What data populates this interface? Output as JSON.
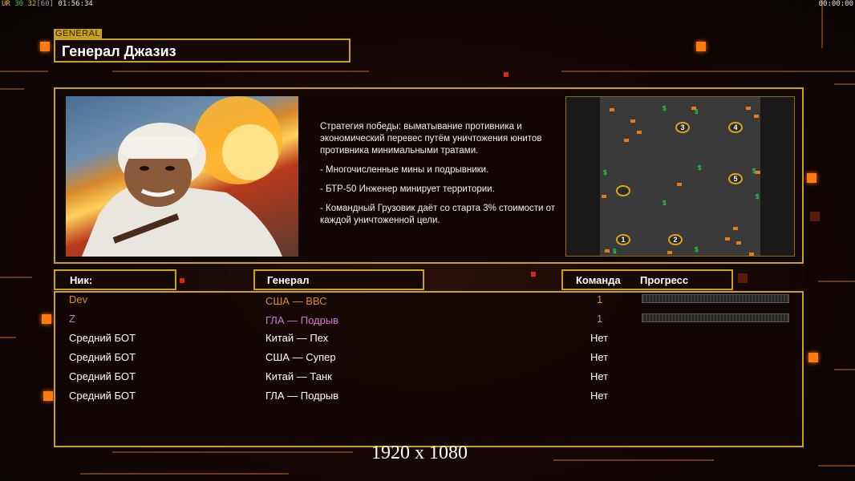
{
  "hud": {
    "ur_label": "UR",
    "fps_a": "30",
    "fps_b": "32",
    "fps_c": "[60]",
    "time_left": "01:56:34",
    "time_right": "00:00:00"
  },
  "header": {
    "tag": "GENERAL",
    "title": "Генерал Джазиз"
  },
  "description": {
    "strategy": "Стратегия победы: выматывание противника и экономический перевес путём уничтожения юнитов противника минимальными тратами.",
    "bullet1": "- Многочисленные мины и подрывники.",
    "bullet2": "- БТР-50 Инженер минирует территории.",
    "bullet3": "- Командный Грузовик даёт со старта 3% стоимости от каждой уничтоженной цели."
  },
  "map": {
    "starts": [
      "1",
      "2",
      "3",
      "4",
      "5"
    ],
    "colors": {
      "start_ring": "#d9a51a",
      "money": "#29d14a",
      "unit": "#e57a1a"
    }
  },
  "table": {
    "headers": {
      "nick": "Ник:",
      "general": "Генерал",
      "team": "Команда",
      "progress": "Прогресс"
    },
    "rows": [
      {
        "nick": "Dev",
        "general": "США — ВВС",
        "team": "1",
        "color": "#e08a2a",
        "progress": 0
      },
      {
        "nick": "Z",
        "general": "ГЛА — Подрыв",
        "team": "1",
        "color": "#d07ad8",
        "progress": 0
      },
      {
        "nick": "Средний БОТ",
        "general": "Китай — Пех",
        "team": "Нет",
        "color": "#ffffff"
      },
      {
        "nick": "Средний БОТ",
        "general": "США — Супер",
        "team": "Нет",
        "color": "#ffffff"
      },
      {
        "nick": "Средний БОТ",
        "general": "Китай — Танк",
        "team": "Нет",
        "color": "#ffffff"
      },
      {
        "nick": "Средний БОТ",
        "general": "ГЛА — Подрыв",
        "team": "Нет",
        "color": "#ffffff"
      }
    ]
  },
  "watermark": "1920 x 1080",
  "colors": {
    "frame": "#c8a21a",
    "accent": "#ff7a12"
  }
}
